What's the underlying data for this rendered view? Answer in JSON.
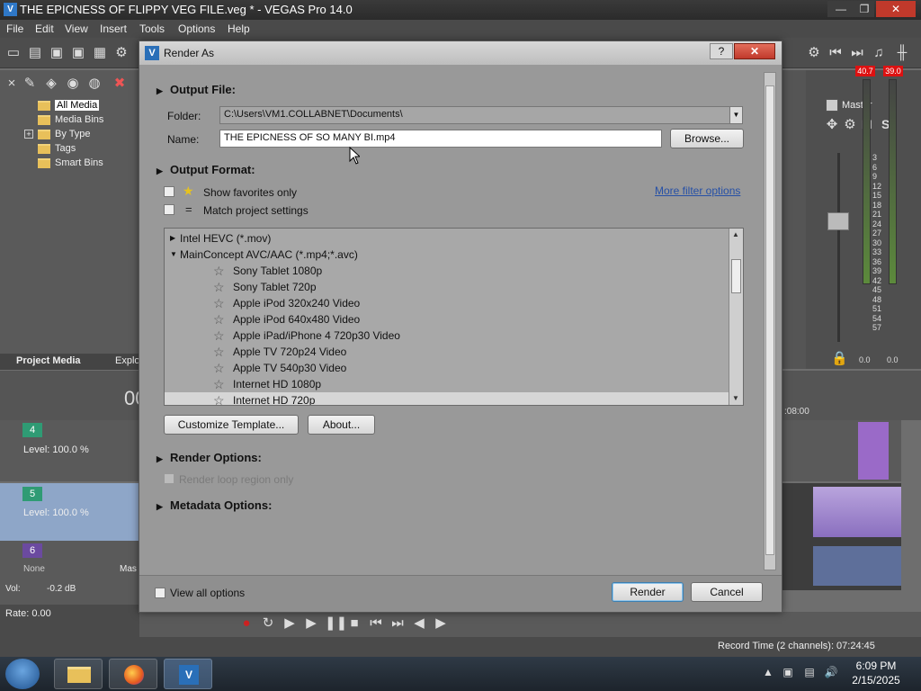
{
  "app": {
    "title": "THE EPICNESS OF FLIPPY VEG FILE.veg * - VEGAS Pro 14.0",
    "icon": "vegas-icon",
    "window_buttons": [
      "—",
      "❐",
      "✕"
    ]
  },
  "menu": [
    "File",
    "Edit",
    "View",
    "Insert",
    "Tools",
    "Options",
    "Help"
  ],
  "media_tree": [
    {
      "label": "All Media",
      "selected": true
    },
    {
      "label": "Media Bins"
    },
    {
      "label": "By Type",
      "expand": "+"
    },
    {
      "label": "Tags"
    },
    {
      "label": "Smart Bins"
    }
  ],
  "media_tabs": [
    "Project Media",
    "Explo"
  ],
  "master": {
    "title": "Master",
    "peak_left": "40.7",
    "peak_right": "39.0",
    "scale": [
      "3",
      "6",
      "9",
      "12",
      "15",
      "18",
      "21",
      "24",
      "27",
      "30",
      "33",
      "36",
      "39",
      "42",
      "45",
      "48",
      "51",
      "54",
      "57"
    ],
    "bottom_left": "0.0",
    "bottom_right": "0.0",
    "ms": [
      "M",
      "S"
    ]
  },
  "timeline": {
    "timecode": "00",
    "ruler_label": ":08:00",
    "tracks": [
      {
        "number": "4",
        "level": "Level: 100.0 %",
        "color": "#2f9b74"
      },
      {
        "number": "5",
        "level": "Level: 100.0 %",
        "color": "#2f9b74"
      },
      {
        "number": "6",
        "level": "",
        "color": "#6b4aa0",
        "extra": "None",
        "vol": "Vol:",
        "vol_val": "-0.2 dB",
        "mas": "Mas"
      }
    ]
  },
  "status": {
    "rate": "Rate: 0.00",
    "record_time": "Record Time (2 channels): 07:24:45"
  },
  "taskbar": {
    "time": "6:09 PM",
    "date": "2/15/2025"
  },
  "dialog": {
    "title": "Render As",
    "help": "?",
    "close": "✕",
    "output_file": {
      "header": "Output File:",
      "folder_label": "Folder:",
      "folder_value": "C:\\Users\\VM1.COLLABNET\\Documents\\",
      "name_label": "Name:",
      "name_value": "THE EPICNESS OF SO MANY BI.mp4",
      "browse": "Browse..."
    },
    "output_format": {
      "header": "Output Format:",
      "show_favorites": "Show favorites only",
      "match_project": "Match project settings",
      "more_filter": "More filter options",
      "match_icon": "="
    },
    "templates": [
      {
        "type": "group",
        "arrow": "▶",
        "label": "Intel HEVC (*.mov)"
      },
      {
        "type": "group",
        "arrow": "▼",
        "label": "MainConcept AVC/AAC (*.mp4;*.avc)"
      },
      {
        "type": "item",
        "label": "Sony Tablet 1080p"
      },
      {
        "type": "item",
        "label": "Sony Tablet 720p"
      },
      {
        "type": "item",
        "label": "Apple iPod 320x240 Video"
      },
      {
        "type": "item",
        "label": "Apple iPod 640x480 Video"
      },
      {
        "type": "item",
        "label": "Apple iPad/iPhone 4 720p30 Video"
      },
      {
        "type": "item",
        "label": "Apple TV 720p24 Video"
      },
      {
        "type": "item",
        "label": "Apple TV 540p30 Video"
      },
      {
        "type": "item",
        "label": "Internet HD 1080p"
      },
      {
        "type": "item",
        "label": "Internet HD 720p",
        "selected": true
      }
    ],
    "customize_template": "Customize Template...",
    "about": "About...",
    "render_options": {
      "header": "Render Options:",
      "loop_region": "Render loop region only"
    },
    "metadata_options": {
      "header": "Metadata Options:"
    },
    "view_all": "View all options",
    "render": "Render",
    "cancel": "Cancel"
  }
}
